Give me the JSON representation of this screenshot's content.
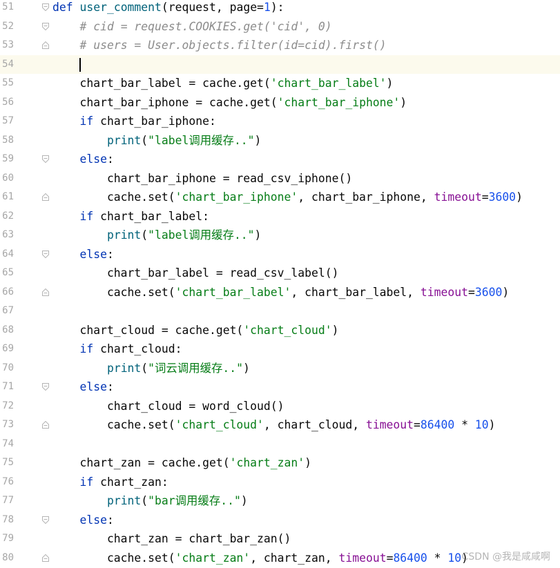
{
  "theme": {
    "keyword": "#0033b3",
    "function": "#00627a",
    "string": "#067d17",
    "number": "#1750eb",
    "comment": "#8c8c8c",
    "param": "#871094",
    "current_line": "#fcfaed"
  },
  "editor": {
    "current_line": 54,
    "lines": [
      {
        "n": "51",
        "fold": "open",
        "tokens": [
          [
            "kw",
            "def "
          ],
          [
            "fn",
            "user_comment"
          ],
          [
            "plain",
            "(request, page="
          ],
          [
            "num",
            "1"
          ],
          [
            "plain",
            "):"
          ]
        ]
      },
      {
        "n": "52",
        "fold": "open",
        "tokens": [
          [
            "plain",
            "    "
          ],
          [
            "cmt",
            "# cid = request.COOKIES.get('cid', 0)"
          ]
        ]
      },
      {
        "n": "53",
        "fold": "close",
        "tokens": [
          [
            "plain",
            "    "
          ],
          [
            "cmt",
            "# users = User.objects.filter(id=cid).first()"
          ]
        ]
      },
      {
        "n": "54",
        "fold": "",
        "tokens": [
          [
            "plain",
            ""
          ]
        ]
      },
      {
        "n": "55",
        "fold": "",
        "tokens": [
          [
            "plain",
            "    chart_bar_label = cache.get("
          ],
          [
            "str",
            "'chart_bar_label'"
          ],
          [
            "plain",
            ")"
          ]
        ]
      },
      {
        "n": "56",
        "fold": "",
        "tokens": [
          [
            "plain",
            "    chart_bar_iphone = cache.get("
          ],
          [
            "str",
            "'chart_bar_iphone'"
          ],
          [
            "plain",
            ")"
          ]
        ]
      },
      {
        "n": "57",
        "fold": "",
        "tokens": [
          [
            "plain",
            "    "
          ],
          [
            "kw",
            "if "
          ],
          [
            "plain",
            "chart_bar_iphone:"
          ]
        ]
      },
      {
        "n": "58",
        "fold": "",
        "tokens": [
          [
            "plain",
            "        "
          ],
          [
            "fn",
            "print"
          ],
          [
            "plain",
            "("
          ],
          [
            "str",
            "\"label调用缓存..\""
          ],
          [
            "plain",
            ")"
          ]
        ]
      },
      {
        "n": "59",
        "fold": "open",
        "tokens": [
          [
            "plain",
            "    "
          ],
          [
            "kw",
            "else"
          ],
          [
            "plain",
            ":"
          ]
        ]
      },
      {
        "n": "60",
        "fold": "",
        "tokens": [
          [
            "plain",
            "        chart_bar_iphone = read_csv_iphone()"
          ]
        ]
      },
      {
        "n": "61",
        "fold": "close",
        "tokens": [
          [
            "plain",
            "        cache.set("
          ],
          [
            "str",
            "'chart_bar_iphone'"
          ],
          [
            "plain",
            ", chart_bar_iphone, "
          ],
          [
            "param",
            "timeout"
          ],
          [
            "plain",
            "="
          ],
          [
            "num",
            "3600"
          ],
          [
            "plain",
            ")"
          ]
        ]
      },
      {
        "n": "62",
        "fold": "",
        "tokens": [
          [
            "plain",
            "    "
          ],
          [
            "kw",
            "if "
          ],
          [
            "plain",
            "chart_bar_label:"
          ]
        ]
      },
      {
        "n": "63",
        "fold": "",
        "tokens": [
          [
            "plain",
            "        "
          ],
          [
            "fn",
            "print"
          ],
          [
            "plain",
            "("
          ],
          [
            "str",
            "\"label调用缓存..\""
          ],
          [
            "plain",
            ")"
          ]
        ]
      },
      {
        "n": "64",
        "fold": "open",
        "tokens": [
          [
            "plain",
            "    "
          ],
          [
            "kw",
            "else"
          ],
          [
            "plain",
            ":"
          ]
        ]
      },
      {
        "n": "65",
        "fold": "",
        "tokens": [
          [
            "plain",
            "        chart_bar_label = read_csv_label()"
          ]
        ]
      },
      {
        "n": "66",
        "fold": "close",
        "tokens": [
          [
            "plain",
            "        cache.set("
          ],
          [
            "str",
            "'chart_bar_label'"
          ],
          [
            "plain",
            ", chart_bar_label, "
          ],
          [
            "param",
            "timeout"
          ],
          [
            "plain",
            "="
          ],
          [
            "num",
            "3600"
          ],
          [
            "plain",
            ")"
          ]
        ]
      },
      {
        "n": "67",
        "fold": "",
        "tokens": [
          [
            "plain",
            ""
          ]
        ]
      },
      {
        "n": "68",
        "fold": "",
        "tokens": [
          [
            "plain",
            "    chart_cloud = cache.get("
          ],
          [
            "str",
            "'chart_cloud'"
          ],
          [
            "plain",
            ")"
          ]
        ]
      },
      {
        "n": "69",
        "fold": "",
        "tokens": [
          [
            "plain",
            "    "
          ],
          [
            "kw",
            "if "
          ],
          [
            "plain",
            "chart_cloud:"
          ]
        ]
      },
      {
        "n": "70",
        "fold": "",
        "tokens": [
          [
            "plain",
            "        "
          ],
          [
            "fn",
            "print"
          ],
          [
            "plain",
            "("
          ],
          [
            "str",
            "\"词云调用缓存..\""
          ],
          [
            "plain",
            ")"
          ]
        ]
      },
      {
        "n": "71",
        "fold": "open",
        "tokens": [
          [
            "plain",
            "    "
          ],
          [
            "kw",
            "else"
          ],
          [
            "plain",
            ":"
          ]
        ]
      },
      {
        "n": "72",
        "fold": "",
        "tokens": [
          [
            "plain",
            "        chart_cloud = word_cloud()"
          ]
        ]
      },
      {
        "n": "73",
        "fold": "close",
        "tokens": [
          [
            "plain",
            "        cache.set("
          ],
          [
            "str",
            "'chart_cloud'"
          ],
          [
            "plain",
            ", chart_cloud, "
          ],
          [
            "param",
            "timeout"
          ],
          [
            "plain",
            "="
          ],
          [
            "num",
            "86400"
          ],
          [
            "plain",
            " * "
          ],
          [
            "num",
            "10"
          ],
          [
            "plain",
            ")"
          ]
        ]
      },
      {
        "n": "74",
        "fold": "",
        "tokens": [
          [
            "plain",
            ""
          ]
        ]
      },
      {
        "n": "75",
        "fold": "",
        "tokens": [
          [
            "plain",
            "    chart_zan = cache.get("
          ],
          [
            "str",
            "'chart_zan'"
          ],
          [
            "plain",
            ")"
          ]
        ]
      },
      {
        "n": "76",
        "fold": "",
        "tokens": [
          [
            "plain",
            "    "
          ],
          [
            "kw",
            "if "
          ],
          [
            "plain",
            "chart_zan:"
          ]
        ]
      },
      {
        "n": "77",
        "fold": "",
        "tokens": [
          [
            "plain",
            "        "
          ],
          [
            "fn",
            "print"
          ],
          [
            "plain",
            "("
          ],
          [
            "str",
            "\"bar调用缓存..\""
          ],
          [
            "plain",
            ")"
          ]
        ]
      },
      {
        "n": "78",
        "fold": "open",
        "tokens": [
          [
            "plain",
            "    "
          ],
          [
            "kw",
            "else"
          ],
          [
            "plain",
            ":"
          ]
        ]
      },
      {
        "n": "79",
        "fold": "",
        "tokens": [
          [
            "plain",
            "        chart_zan = chart_bar_zan()"
          ]
        ]
      },
      {
        "n": "80",
        "fold": "close",
        "tokens": [
          [
            "plain",
            "        cache.set("
          ],
          [
            "str",
            "'chart_zan'"
          ],
          [
            "plain",
            ", chart_zan, "
          ],
          [
            "param",
            "timeout"
          ],
          [
            "plain",
            "="
          ],
          [
            "num",
            "86400"
          ],
          [
            "plain",
            " * "
          ],
          [
            "num",
            "10"
          ],
          [
            "plain",
            ")"
          ]
        ]
      }
    ]
  },
  "watermark": "CSDN @我是咸咸啊"
}
